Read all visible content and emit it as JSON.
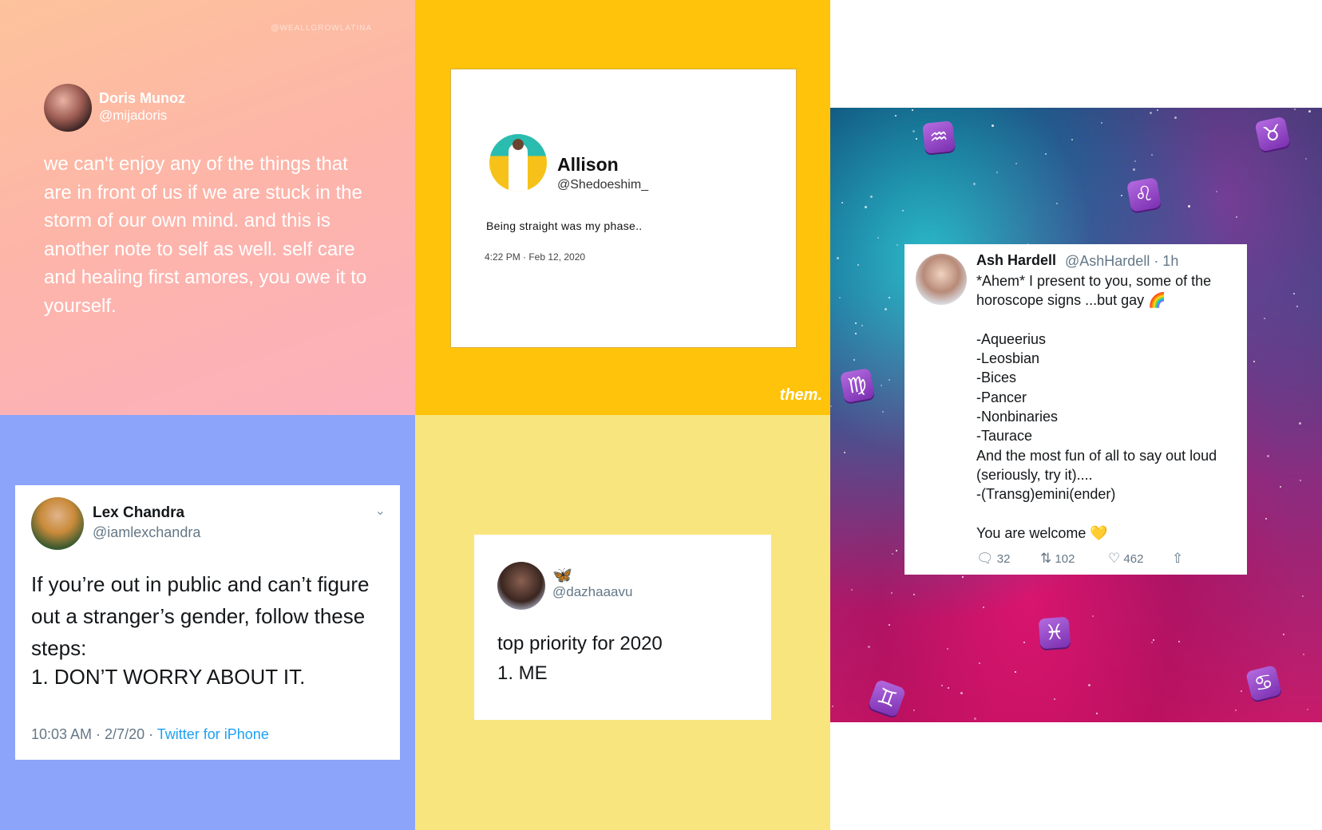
{
  "panel1": {
    "watermark": "@WEALLGROWLATINA",
    "name": "Doris Munoz",
    "handle": "@mijadoris",
    "text": "we can't enjoy any of the things that are in front of us if we are stuck in the storm of our own mind. and this is another note to self as well. self care and healing first amores, you owe it to yourself."
  },
  "panel2": {
    "name": "Allison",
    "handle": "@Shedoeshim_",
    "text": "Being straight was my phase..",
    "timestamp": "4:22 PM · Feb 12, 2020",
    "brand": "them."
  },
  "panel3": {
    "name": "Lex Chandra",
    "handle": "@iamlexchandra",
    "text": "If you’re out in public and can’t figure out a stranger’s gender, follow these steps:",
    "list_item": "1. DON’T WORRY ABOUT IT.",
    "time": "10:03 AM · 2/7/20 · ",
    "source": "Twitter for iPhone"
  },
  "panel4": {
    "name_emoji": "🦋",
    "handle": "@dazhaaavu",
    "line1": "top priority for 2020",
    "line2": "1. ME"
  },
  "panel5": {
    "name": "Ash Hardell",
    "handle_time": "@AshHardell · 1h",
    "body": "*Ahem* I present to you, some of the horoscope signs ...but gay 🌈\n\n-Aqueerius\n-Leosbian\n-Bices\n-Pancer\n-Nonbinaries\n-Taurace\nAnd the most fun of all to say out loud (seriously, try it)....\n-(Transg)emini(ender)\n\nYou are welcome 💛",
    "replies": "32",
    "retweets": "102",
    "likes": "462",
    "zodiac": [
      "♒",
      "♉",
      "♌",
      "♍",
      "♓",
      "♋",
      "♊"
    ]
  }
}
